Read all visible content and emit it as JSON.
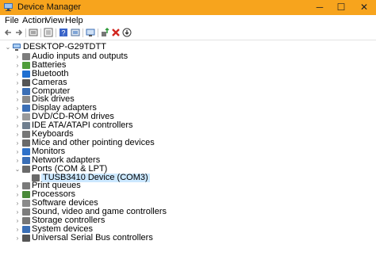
{
  "window": {
    "title": "Device Manager",
    "accent": "#f7a41d",
    "controls": {
      "minimize": "─",
      "maximize": "☐",
      "close": "✕"
    }
  },
  "menu": [
    "File",
    "Action",
    "View",
    "Help"
  ],
  "toolbar": [
    {
      "name": "back-icon",
      "glyph": "←"
    },
    {
      "name": "forward-icon",
      "glyph": "→"
    },
    {
      "name": "properties-icon",
      "glyph": "▣"
    },
    {
      "name": "show-hidden-icon",
      "glyph": "▤"
    },
    {
      "name": "help-icon",
      "glyph": "?"
    },
    {
      "name": "devices-by-type-icon",
      "glyph": "▥"
    },
    {
      "name": "scan-hardware-icon",
      "glyph": "▦"
    },
    {
      "name": "update-driver-icon",
      "glyph": "⇪"
    },
    {
      "name": "uninstall-icon",
      "glyph": "✖"
    },
    {
      "name": "disable-icon",
      "glyph": "⊛"
    }
  ],
  "tree": {
    "root": "DESKTOP-G29TDTT",
    "categories": [
      {
        "label": "Audio inputs and outputs",
        "icon": "speaker-icon"
      },
      {
        "label": "Batteries",
        "icon": "battery-icon"
      },
      {
        "label": "Bluetooth",
        "icon": "bluetooth-icon"
      },
      {
        "label": "Cameras",
        "icon": "camera-icon"
      },
      {
        "label": "Computer",
        "icon": "computer-icon"
      },
      {
        "label": "Disk drives",
        "icon": "disk-icon"
      },
      {
        "label": "Display adapters",
        "icon": "display-icon"
      },
      {
        "label": "DVD/CD-ROM drives",
        "icon": "dvd-icon"
      },
      {
        "label": "IDE ATA/ATAPI controllers",
        "icon": "ide-icon"
      },
      {
        "label": "Keyboards",
        "icon": "keyboard-icon"
      },
      {
        "label": "Mice and other pointing devices",
        "icon": "mouse-icon"
      },
      {
        "label": "Monitors",
        "icon": "monitor-icon"
      },
      {
        "label": "Network adapters",
        "icon": "network-icon"
      },
      {
        "label": "Ports (COM & LPT)",
        "icon": "port-icon",
        "expanded": true,
        "children": [
          {
            "label": "TUSB3410 Device (COM3)",
            "icon": "port-device-icon",
            "selected": true
          }
        ]
      },
      {
        "label": "Print queues",
        "icon": "printer-icon"
      },
      {
        "label": "Processors",
        "icon": "processor-icon"
      },
      {
        "label": "Software devices",
        "icon": "software-icon"
      },
      {
        "label": "Sound, video and game controllers",
        "icon": "sound-icon"
      },
      {
        "label": "Storage controllers",
        "icon": "storage-icon"
      },
      {
        "label": "System devices",
        "icon": "system-icon"
      },
      {
        "label": "Universal Serial Bus controllers",
        "icon": "usb-icon"
      }
    ]
  }
}
